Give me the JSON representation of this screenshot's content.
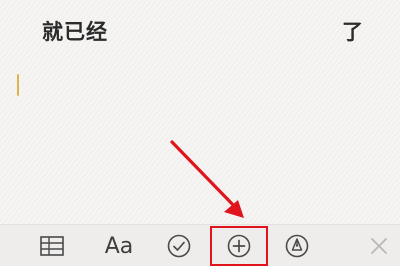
{
  "note": {
    "line_left": "就已经",
    "line_right": "了"
  },
  "toolbar": {
    "items": [
      {
        "name": "table-icon"
      },
      {
        "name": "format-text-button",
        "label": "Aa"
      },
      {
        "name": "checklist-icon"
      },
      {
        "name": "add-icon"
      },
      {
        "name": "markup-pen-icon"
      },
      {
        "name": "close-icon"
      }
    ]
  },
  "annotation": {
    "arrow_color": "#e0141c",
    "highlight_color": "#e0141c"
  },
  "colors": {
    "cursor": "#e0b44a",
    "background": "#f3f2f0",
    "toolbar": "#eeedeb"
  }
}
